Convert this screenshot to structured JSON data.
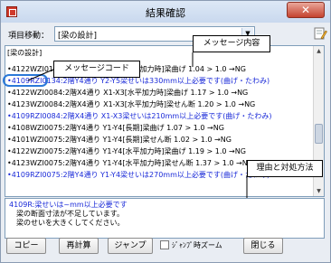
{
  "window": {
    "title": "結果確認",
    "close_glyph": "✕"
  },
  "jump": {
    "label": "項目移動：",
    "selected": "[梁の設計]"
  },
  "list": {
    "items": [
      {
        "text": "[梁の設計]",
        "color": "black"
      },
      {
        "text": "•4122WZI0134:2階Y4通り Y2-Y5[水平加力時]梁曲げ 1.04 > 1.0 →NG",
        "color": "black"
      },
      {
        "text": "•4109RZI0134:2階Y4通り Y2-Y5梁せいは330mm以上必要です(曲げ・たわみ)",
        "color": "blue"
      },
      {
        "text": "•4122WZI0084:2階X4通り X1-X3[水平加力時]梁曲げ 1.17 > 1.0 →NG",
        "color": "black"
      },
      {
        "text": "•4123WZI0084:2階X4通り X1-X3[水平加力時]梁せん断 1.20 > 1.0 →NG",
        "color": "black"
      },
      {
        "text": "•4109RZI0084:2階X4通り X1-X3梁せいは210mm以上必要です(曲げ・たわみ)",
        "color": "blue"
      },
      {
        "text": "•4108WZI0075:2階Y4通り Y1-Y4[長期]梁曲げ 1.07 > 1.0 →NG",
        "color": "black"
      },
      {
        "text": "•4101WZI0075:2階Y4通り Y1-Y4[長期]梁せん断 1.02 > 1.0 →NG",
        "color": "black"
      },
      {
        "text": "•4122WZI0075:2階Y4通り Y1-Y4[水平加力時]梁曲げ 1.19 > 1.0 →NG",
        "color": "black"
      },
      {
        "text": "•4123WZI0075:2階Y4通り Y1-Y4[水平加力時]梁せん断 1.37 > 1.0 →NG",
        "color": "black"
      },
      {
        "text": "•4109RZI0075:2階Y4通り Y1-Y4梁せいは270mm以上必要です(曲げ・たわみ)",
        "color": "blue"
      }
    ]
  },
  "callouts": {
    "message_code": "メッセージコード",
    "message_content": "メッセージ内容",
    "reason": "理由と対処方法"
  },
  "details": {
    "heading": "4109R:梁せいは~mm以上必要です",
    "lines": [
      "梁の断面寸法が不足しています。",
      "梁のせいを大きくしてください。"
    ]
  },
  "buttons": {
    "copy": "コピー",
    "recalc": "再計算",
    "jump": "ジャンプ",
    "jump_zoom": "ｼﾞｬﾝﾌﾟ時ズーム",
    "close": "閉じる"
  }
}
